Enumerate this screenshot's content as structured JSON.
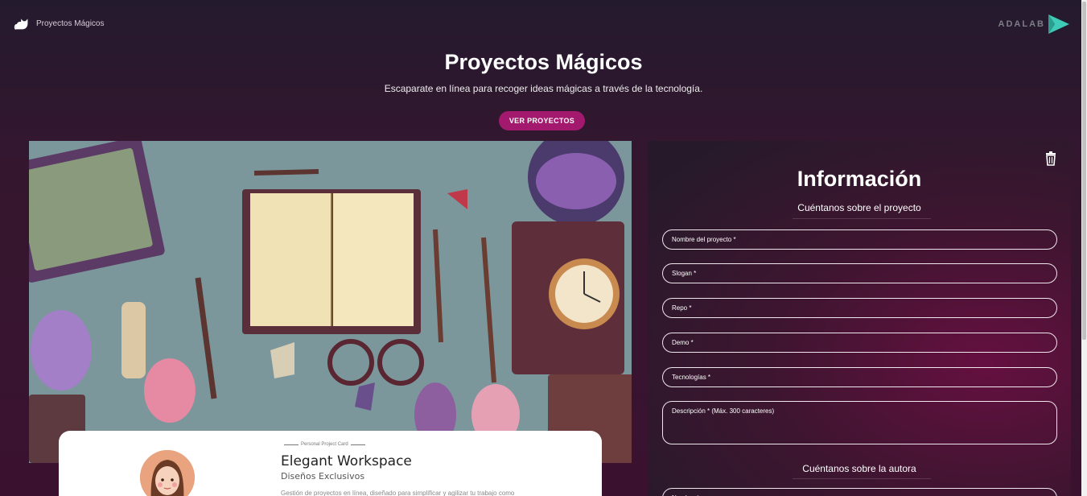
{
  "header": {
    "brand_label": "Proyectos Mágicos",
    "partner_logo_text": "ADALAB"
  },
  "hero": {
    "title": "Proyectos Mágicos",
    "subtitle": "Escaparate en línea para recoger ideas mágicas a través de la tecnología.",
    "cta_label": "VER PROYECTOS"
  },
  "card": {
    "tag": "Personal Project Card",
    "project_name": "Elegant Workspace",
    "slogan": "Diseños Exclusivos",
    "description": "Gestión de proyectos en línea, diseñado para simplificar y agilizar tu trabajo como"
  },
  "form": {
    "title": "Información",
    "section_project": "Cuéntanos sobre el proyecto",
    "fields": [
      {
        "placeholder": "Nombre del proyecto *"
      },
      {
        "placeholder": "Slogan *"
      },
      {
        "placeholder": "Repo *"
      },
      {
        "placeholder": "Demo *"
      },
      {
        "placeholder": "Tecnologías *"
      },
      {
        "placeholder": "Descripción * (Máx. 300 caracteres)"
      }
    ],
    "section_author": "Cuéntanos sobre la autora",
    "author_field_partial": "Nombre *"
  },
  "colors": {
    "accent": "#a3196e",
    "panel_glow": "#651040",
    "background": "#2a1a2c"
  },
  "icons": {
    "brand": "cat-icon",
    "delete": "trash-icon",
    "partner": "adalab-logo"
  }
}
